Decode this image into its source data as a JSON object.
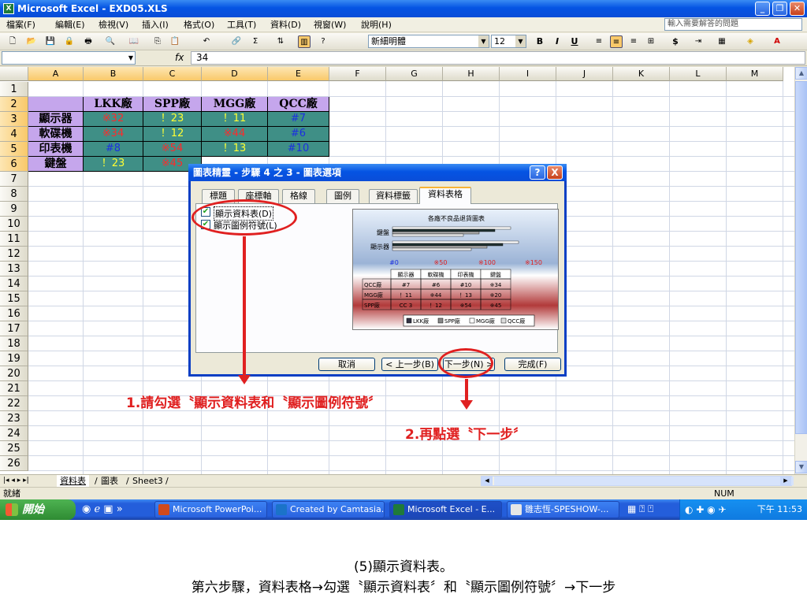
{
  "window": {
    "title": "Microsoft Excel - EXD05.XLS",
    "icon": "excel-icon"
  },
  "menu": {
    "items": [
      "檔案(F)",
      "編輯(E)",
      "檢視(V)",
      "插入(I)",
      "格式(O)",
      "工具(T)",
      "資料(D)",
      "視窗(W)",
      "說明(H)"
    ],
    "help_placeholder": "輸入需要解答的問題"
  },
  "toolbar": {
    "font_name": "新細明體",
    "font_size": "12",
    "bold": "B",
    "italic": "I",
    "underline": "U",
    "sigma": "Σ",
    "currency": "$"
  },
  "formula_bar": {
    "name_box": "",
    "fx": "fx",
    "value": "34"
  },
  "columns": [
    "A",
    "B",
    "C",
    "D",
    "E",
    "F",
    "G",
    "H",
    "I",
    "J",
    "K",
    "L",
    "M"
  ],
  "rows": [
    "1",
    "2",
    "3",
    "4",
    "5",
    "6",
    "7",
    "8",
    "9",
    "10",
    "11",
    "12",
    "13",
    "14",
    "15",
    "16",
    "17",
    "18",
    "19",
    "20",
    "21",
    "22",
    "23",
    "24",
    "25",
    "26"
  ],
  "table": {
    "headers": [
      "LKK廠",
      "SPP廠",
      "MGG廠",
      "QCC廠"
    ],
    "rows": [
      {
        "label": "顯示器",
        "values": [
          "※32",
          "！23",
          "！11",
          "#7"
        ]
      },
      {
        "label": "軟碟機",
        "values": [
          "※34",
          "！12",
          "※44",
          "#6"
        ]
      },
      {
        "label": "印表機",
        "values": [
          "#8",
          "※54",
          "！13",
          "#10"
        ]
      },
      {
        "label": "鍵盤",
        "values": [
          "！23",
          "※45",
          "",
          ""
        ]
      }
    ]
  },
  "sheets": {
    "tabs": [
      "資料表",
      "圖表",
      "Sheet3"
    ],
    "active": "資料表"
  },
  "status": {
    "left": "就緒",
    "num": "NUM"
  },
  "taskbar": {
    "start": "開始",
    "tasks": [
      "Microsoft PowerPoi...",
      "Created by Camtasia...",
      "Microsoft Excel - E...",
      "雛志恆-SPESHOW-..."
    ],
    "clock": "下午 11:53"
  },
  "dialog": {
    "title": "圖表精靈 - 步驟 4 之 3 - 圖表選項",
    "help_btn": "?",
    "close_btn": "X",
    "tabs": [
      "標題",
      "座標軸",
      "格線",
      "圖例",
      "資料標籤",
      "資料表格"
    ],
    "active_tab": "資料表格",
    "checkbox1": {
      "label": "顯示資料表(D)",
      "checked": true
    },
    "checkbox2": {
      "label": "顯示圖例符號(L)",
      "checked": true
    },
    "preview": {
      "title": "各廠不良品退貨圖表",
      "categories": [
        "鍵盤",
        "顯示器"
      ],
      "axis_ticks": [
        "#0",
        "※50",
        "※100",
        "※150"
      ],
      "table_header": [
        "",
        "顯示器",
        "軟碟機",
        "印表機",
        "鍵盤"
      ],
      "table_rows": [
        [
          "QCC廠",
          "#7",
          "#6",
          "#10",
          "※34"
        ],
        [
          "MGG廠",
          "！11",
          "※44",
          "！13",
          "※20"
        ],
        [
          "SPP廠",
          "CC 3",
          "！12",
          "※54",
          "※45"
        ]
      ],
      "legend": [
        "LKK廠",
        "SPP廠",
        "MGG廠",
        "QCC廠"
      ]
    },
    "buttons": {
      "cancel": "取消",
      "back": "< 上一步(B)",
      "next": "下一步(N) >",
      "finish": "完成(F)"
    }
  },
  "annotations": {
    "step1": "1.請勾選〝顯示資料表和〝顯示圖例符號〞",
    "step2": "2.再點選〝下一步〞"
  },
  "caption": {
    "line1": "(5)顯示資料表。",
    "line2": "第六步驟，資料表格→勾選〝顯示資料表〞和〝顯示圖例符號〞→下一步"
  },
  "colors": {
    "header_purple": "#c5a6ec",
    "cell_teal": "#3f8f86",
    "annotation_red": "#e02020",
    "xp_blue": "#0554e3"
  }
}
